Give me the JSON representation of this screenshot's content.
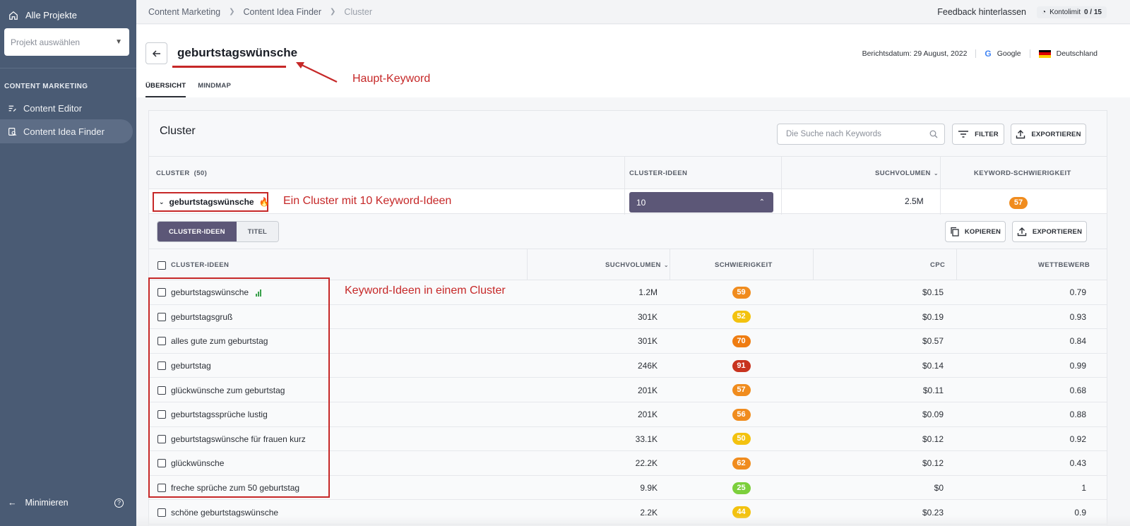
{
  "sidebar": {
    "home_label": "Alle Projekte",
    "project_select_placeholder": "Projekt auswählen",
    "section_label": "CONTENT MARKETING",
    "items": [
      {
        "label": "Content Editor",
        "icon": "edit-list-icon",
        "active": false
      },
      {
        "label": "Content Idea Finder",
        "icon": "idea-search-icon",
        "active": true
      }
    ],
    "minimize_label": "Minimieren"
  },
  "topbar": {
    "breadcrumb": [
      "Content Marketing",
      "Content Idea Finder",
      "Cluster"
    ],
    "feedback_label": "Feedback hinterlassen",
    "limit_label": "Kontolimit",
    "limit_value": "0 / 15"
  },
  "header": {
    "keyword": "geburtstagswünsche",
    "report_date": "Berichtsdatum: 29 August, 2022",
    "engine": "Google",
    "country": "Deutschland",
    "tabs": [
      "ÜBERSICHT",
      "MINDMAP"
    ],
    "annotation_main": "Haupt-Keyword"
  },
  "card": {
    "title": "Cluster",
    "search_placeholder": "Die Suche nach Keywords",
    "filter_label": "FILTER",
    "export_label": "EXPORTIEREN",
    "columns": {
      "cluster": "CLUSTER",
      "cluster_count": "(50)",
      "ideas": "CLUSTER-IDEEN",
      "volume": "SUCHVOLUMEN",
      "difficulty": "KEYWORD-SCHWIERIGKEIT"
    },
    "cluster_row": {
      "name": "geburtstagswünsche",
      "ideas": "10",
      "volume": "2.5M",
      "difficulty": "57",
      "annotation": "Ein Cluster mit 10 Keyword-Ideen"
    },
    "segment": [
      "CLUSTER-IDEEN",
      "TITEL"
    ],
    "copy_label": "KOPIEREN",
    "sub_columns": {
      "ideas": "CLUSTER-IDEEN",
      "volume": "SUCHVOLUMEN",
      "difficulty": "SCHWIERIGKEIT",
      "cpc": "CPC",
      "competition": "WETTBEWERB"
    },
    "rows_annotation": "Keyword-Ideen in einem Cluster",
    "rows": [
      {
        "kw": "geburtstagswünsche",
        "vol": "1.2M",
        "diff": "59",
        "color": "#f08c1e",
        "cpc": "$0.15",
        "comp": "0.79"
      },
      {
        "kw": "geburtstagsgruß",
        "vol": "301K",
        "diff": "52",
        "color": "#f3c20f",
        "cpc": "$0.19",
        "comp": "0.93"
      },
      {
        "kw": "alles gute zum geburtstag",
        "vol": "301K",
        "diff": "70",
        "color": "#ef7d12",
        "cpc": "$0.57",
        "comp": "0.84"
      },
      {
        "kw": "geburtstag",
        "vol": "246K",
        "diff": "91",
        "color": "#c8341f",
        "cpc": "$0.14",
        "comp": "0.99"
      },
      {
        "kw": "glückwünsche zum geburtstag",
        "vol": "201K",
        "diff": "57",
        "color": "#f08c1e",
        "cpc": "$0.11",
        "comp": "0.68"
      },
      {
        "kw": "geburtstagssprüche lustig",
        "vol": "201K",
        "diff": "56",
        "color": "#f08c1e",
        "cpc": "$0.09",
        "comp": "0.88"
      },
      {
        "kw": "geburtstagswünsche für frauen kurz",
        "vol": "33.1K",
        "diff": "50",
        "color": "#f3c20f",
        "cpc": "$0.12",
        "comp": "0.92"
      },
      {
        "kw": "glückwünsche",
        "vol": "22.2K",
        "diff": "62",
        "color": "#f08c1e",
        "cpc": "$0.12",
        "comp": "0.43"
      },
      {
        "kw": "freche sprüche zum 50 geburtstag",
        "vol": "9.9K",
        "diff": "25",
        "color": "#7ccf3c",
        "cpc": "$0",
        "comp": "1"
      },
      {
        "kw": "schöne geburtstagswünsche",
        "vol": "2.2K",
        "diff": "44",
        "color": "#f3c20f",
        "cpc": "$0.23",
        "comp": "0.9"
      }
    ]
  }
}
